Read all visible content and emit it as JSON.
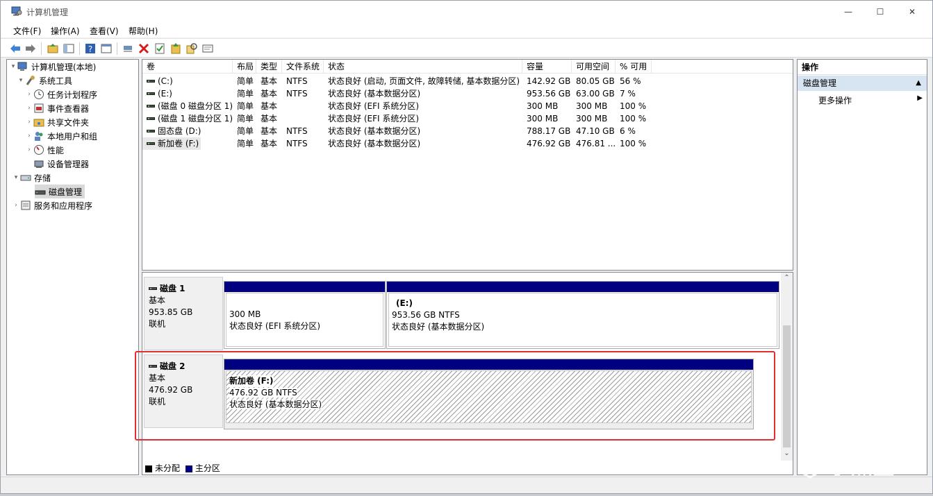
{
  "window": {
    "title": "计算机管理",
    "controls": [
      "—",
      "☐",
      "✕"
    ]
  },
  "menu": [
    "文件(F)",
    "操作(A)",
    "查看(V)",
    "帮助(H)"
  ],
  "toolbar_icons": [
    "back-icon",
    "forward-icon",
    "up-folder-icon",
    "show-hide-tree-icon",
    "help-icon",
    "console-icon",
    "connect-icon",
    "delete-icon",
    "properties-icon",
    "refresh-icon",
    "search-icon",
    "rescan-icon"
  ],
  "tree": {
    "root": "计算机管理(本地)",
    "system_tools": "系统工具",
    "task_scheduler": "任务计划程序",
    "event_viewer": "事件查看器",
    "shared_folders": "共享文件夹",
    "local_users": "本地用户和组",
    "performance": "性能",
    "device_manager": "设备管理器",
    "storage": "存储",
    "disk_management": "磁盘管理",
    "services_apps": "服务和应用程序"
  },
  "volume_list": {
    "columns": [
      "卷",
      "布局",
      "类型",
      "文件系统",
      "状态",
      "容量",
      "可用空间",
      "% 可用"
    ],
    "rows": [
      [
        "(C:)",
        "简单",
        "基本",
        "NTFS",
        "状态良好 (启动, 页面文件, 故障转储, 基本数据分区)",
        "142.92 GB",
        "80.05 GB",
        "56 %"
      ],
      [
        "(E:)",
        "简单",
        "基本",
        "NTFS",
        "状态良好 (基本数据分区)",
        "953.56 GB",
        "63.00 GB",
        "7 %"
      ],
      [
        "(磁盘 0 磁盘分区 1)",
        "简单",
        "基本",
        "",
        "状态良好 (EFI 系统分区)",
        "300 MB",
        "300 MB",
        "100 %"
      ],
      [
        "(磁盘 1 磁盘分区 1)",
        "简单",
        "基本",
        "",
        "状态良好 (EFI 系统分区)",
        "300 MB",
        "300 MB",
        "100 %"
      ],
      [
        "固态盘 (D:)",
        "简单",
        "基本",
        "NTFS",
        "状态良好 (基本数据分区)",
        "788.17 GB",
        "47.10 GB",
        "6 %"
      ],
      [
        "新加卷 (F:)",
        "简单",
        "基本",
        "NTFS",
        "状态良好 (基本数据分区)",
        "476.92 GB",
        "476.81 ...",
        "100 %"
      ]
    ]
  },
  "disks": {
    "disk1": {
      "name": "磁盘 1",
      "type": "基本",
      "size": "953.85 GB",
      "status": "联机",
      "p1": {
        "size": "300 MB",
        "status": "状态良好 (EFI 系统分区)"
      },
      "p2": {
        "name": "(E:)",
        "size": "953.56 GB NTFS",
        "status": "状态良好 (基本数据分区)"
      }
    },
    "disk2": {
      "name": "磁盘 2",
      "type": "基本",
      "size": "476.92 GB",
      "status": "联机",
      "p1": {
        "name": "新加卷  (F:)",
        "size": "476.92 GB NTFS",
        "status": "状态良好 (基本数据分区)"
      }
    }
  },
  "legend": {
    "unallocated": "未分配",
    "primary": "主分区",
    "unallocated_color": "#000000",
    "primary_color": "#000080"
  },
  "actions": {
    "header": "操作",
    "section": "磁盘管理",
    "more": "更多操作"
  },
  "watermark": "小黑盒",
  "colors": {
    "partition_bar": "#000080",
    "highlight": "#e42d2d",
    "actions_section": "#d7e4f2"
  }
}
